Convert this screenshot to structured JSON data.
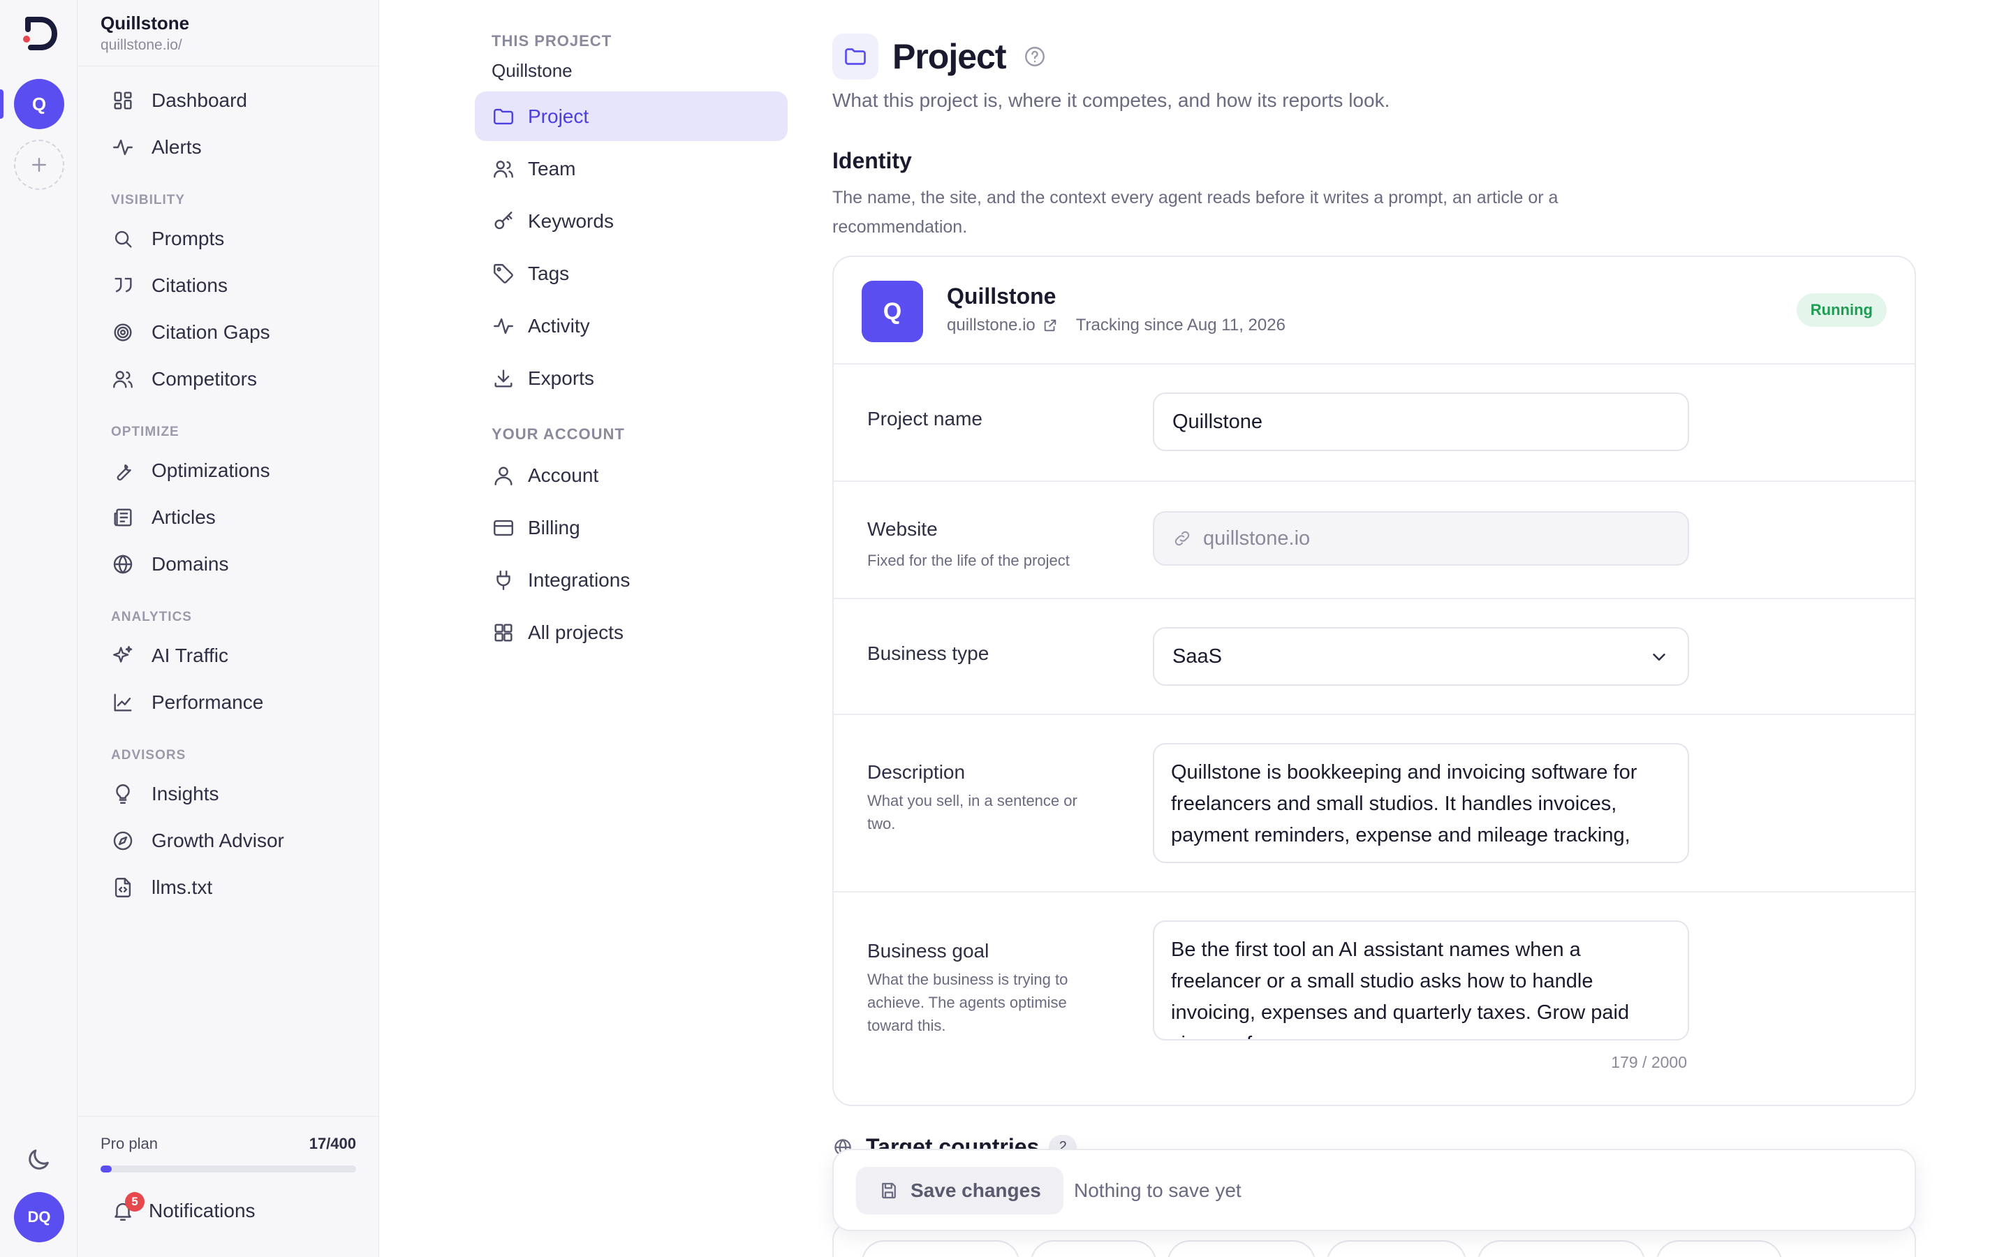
{
  "rail": {
    "project_initial": "Q",
    "user_initials": "DQ",
    "icons": {
      "logo": "brand-logo-icon",
      "add": "plus-icon",
      "theme": "moon-icon"
    }
  },
  "sidebar": {
    "project_name": "Quillstone",
    "project_url": "quillstone.io/",
    "items_top": [
      {
        "label": "Dashboard",
        "icon": "dashboard-icon"
      },
      {
        "label": "Alerts",
        "icon": "activity-icon"
      }
    ],
    "sections": [
      {
        "title": "VISIBILITY",
        "items": [
          {
            "label": "Prompts",
            "icon": "search-icon"
          },
          {
            "label": "Citations",
            "icon": "quote-icon"
          },
          {
            "label": "Citation Gaps",
            "icon": "target-icon"
          },
          {
            "label": "Competitors",
            "icon": "users-icon"
          }
        ]
      },
      {
        "title": "OPTIMIZE",
        "items": [
          {
            "label": "Optimizations",
            "icon": "wrench-icon"
          },
          {
            "label": "Articles",
            "icon": "newspaper-icon"
          },
          {
            "label": "Domains",
            "icon": "globe-icon"
          }
        ]
      },
      {
        "title": "ANALYTICS",
        "items": [
          {
            "label": "AI Traffic",
            "icon": "sparkles-icon"
          },
          {
            "label": "Performance",
            "icon": "line-chart-icon"
          }
        ]
      },
      {
        "title": "ADVISORS",
        "items": [
          {
            "label": "Insights",
            "icon": "lightbulb-icon"
          },
          {
            "label": "Growth Advisor",
            "icon": "compass-icon"
          },
          {
            "label": "llms.txt",
            "icon": "file-code-icon"
          }
        ]
      }
    ],
    "plan": {
      "label": "Pro plan",
      "usage": "17/400",
      "progress": 0.0425
    },
    "notifications": {
      "label": "Notifications",
      "count": "5"
    }
  },
  "settings_nav": {
    "project_section": "THIS PROJECT",
    "project_name": "Quillstone",
    "project_items": [
      {
        "label": "Project",
        "icon": "folder-icon",
        "active": true
      },
      {
        "label": "Team",
        "icon": "users-icon"
      },
      {
        "label": "Keywords",
        "icon": "key-icon"
      },
      {
        "label": "Tags",
        "icon": "tag-icon"
      },
      {
        "label": "Activity",
        "icon": "activity-icon"
      },
      {
        "label": "Exports",
        "icon": "download-icon"
      }
    ],
    "account_section": "YOUR ACCOUNT",
    "account_items": [
      {
        "label": "Account",
        "icon": "user-icon"
      },
      {
        "label": "Billing",
        "icon": "credit-card-icon"
      },
      {
        "label": "Integrations",
        "icon": "plug-icon"
      },
      {
        "label": "All projects",
        "icon": "grid-icon"
      }
    ]
  },
  "main": {
    "title": "Project",
    "subtitle": "What this project is, where it competes, and how its reports look.",
    "identity": {
      "title": "Identity",
      "description": "The name, the site, and the context every agent reads before it writes a prompt, an article or a recommendation."
    },
    "project_card": {
      "initial": "Q",
      "name": "Quillstone",
      "domain": "quillstone.io",
      "tracking": "Tracking since Aug 11, 2026",
      "status": "Running",
      "status_color": "#1f9d55"
    },
    "fields": {
      "project_name": {
        "label": "Project name",
        "value": "Quillstone"
      },
      "website": {
        "label": "Website",
        "help": "Fixed for the life of the project",
        "value": "quillstone.io"
      },
      "business_type": {
        "label": "Business type",
        "value": "SaaS"
      },
      "description": {
        "label": "Description",
        "help": "What you sell, in a sentence or two.",
        "value": "Quillstone is bookkeeping and invoicing software for freelancers and small studios. It handles invoices, payment reminders, expense and mileage tracking,"
      },
      "business_goal": {
        "label": "Business goal",
        "help": "What the business is trying to achieve. The agents optimise toward this.",
        "value": "Be the first tool an AI assistant names when a freelancer or a small studio asks how to handle invoicing, expenses and quarterly taxes. Grow paid signups from",
        "char_count": "179 / 2000"
      }
    },
    "target_countries": {
      "title": "Target countries",
      "count": "2"
    },
    "save_bar": {
      "button": "Save changes",
      "status": "Nothing to save yet"
    }
  },
  "colors": {
    "accent": "#5b4ef0",
    "accent_bg": "#e6e5fb",
    "status_bg": "#e4f6ec",
    "badge_red": "#e5484d"
  }
}
